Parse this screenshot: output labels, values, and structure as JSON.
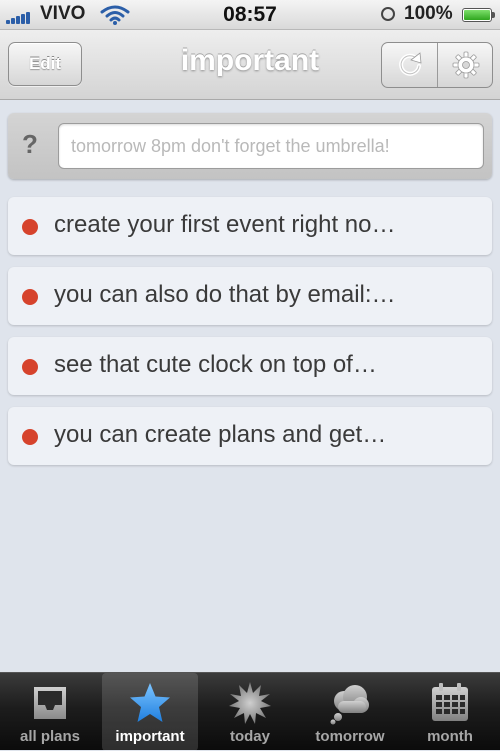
{
  "status_bar": {
    "carrier": "VIVO",
    "time": "08:57",
    "battery_percent": "100%",
    "battery_level": 1.0
  },
  "nav": {
    "edit_label": "Edit",
    "title": "important",
    "refresh_icon": "refresh-icon",
    "settings_icon": "gear-icon"
  },
  "quick_add": {
    "help_label": "?",
    "placeholder": "tomorrow 8pm don't forget the umbrella!",
    "value": ""
  },
  "events": [
    {
      "text": "create your first event right no…",
      "dot_color": "#d6432c"
    },
    {
      "text": "you can also do that by email:…",
      "dot_color": "#d6432c"
    },
    {
      "text": "see that cute clock on top of…",
      "dot_color": "#d6432c"
    },
    {
      "text": "you can create plans and get…",
      "dot_color": "#d6432c"
    }
  ],
  "tabs": [
    {
      "label": "all plans",
      "icon": "inbox-icon",
      "active": false
    },
    {
      "label": "important",
      "icon": "star-icon",
      "active": true
    },
    {
      "label": "today",
      "icon": "sun-icon",
      "active": false
    },
    {
      "label": "tomorrow",
      "icon": "cloud-icon",
      "active": false
    },
    {
      "label": "month",
      "icon": "calendar-icon",
      "active": false
    }
  ],
  "colors": {
    "accent_blue": "#2f8ee8",
    "event_dot": "#d6432c",
    "battery_green": "#2fa61e"
  }
}
